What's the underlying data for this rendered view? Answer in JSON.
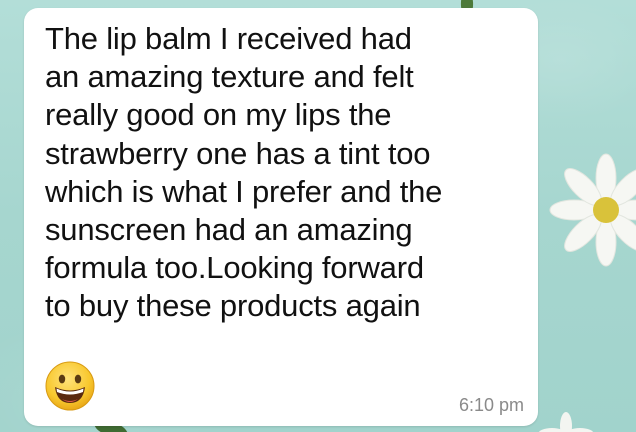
{
  "message": {
    "lines": [
      "The lip balm I received had",
      "an amazing texture and felt",
      "really good on my lips the",
      "strawberry one has a tint too",
      "which is what I prefer and the",
      "sunscreen had an amazing",
      "formula too.Looking forward",
      "to buy these products again"
    ],
    "emoji": "grinning-face-emoji",
    "time": "6:10 pm"
  },
  "colors": {
    "wallpaper": "#a9d9d2",
    "bubble": "#ffffff",
    "text": "#111111",
    "timestamp": "#8a8a8a"
  }
}
